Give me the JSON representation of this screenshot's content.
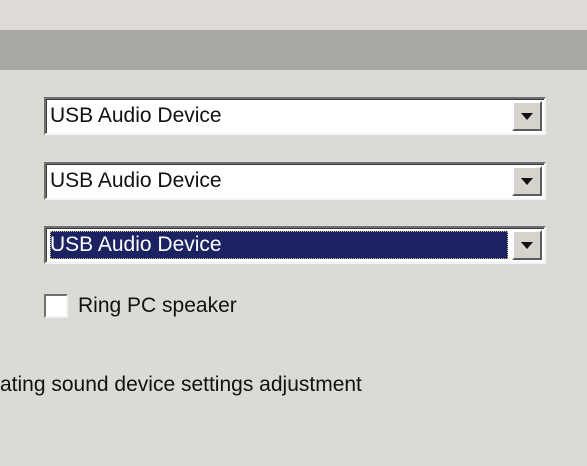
{
  "dialog": {
    "combos": [
      {
        "value": "USB Audio Device",
        "selected": false
      },
      {
        "value": "USB Audio Device",
        "selected": false
      },
      {
        "value": "USB Audio Device",
        "selected": true
      }
    ],
    "ring_pc_speaker": {
      "label": "Ring PC speaker",
      "checked": false
    },
    "status_text": "ating sound device settings adjustment"
  },
  "colors": {
    "selection_background": "#1b2363",
    "dialog_background": "#dcdad5",
    "header_bar": "#a9a7a4"
  },
  "icons": [
    "dropdown-arrow-icon"
  ]
}
